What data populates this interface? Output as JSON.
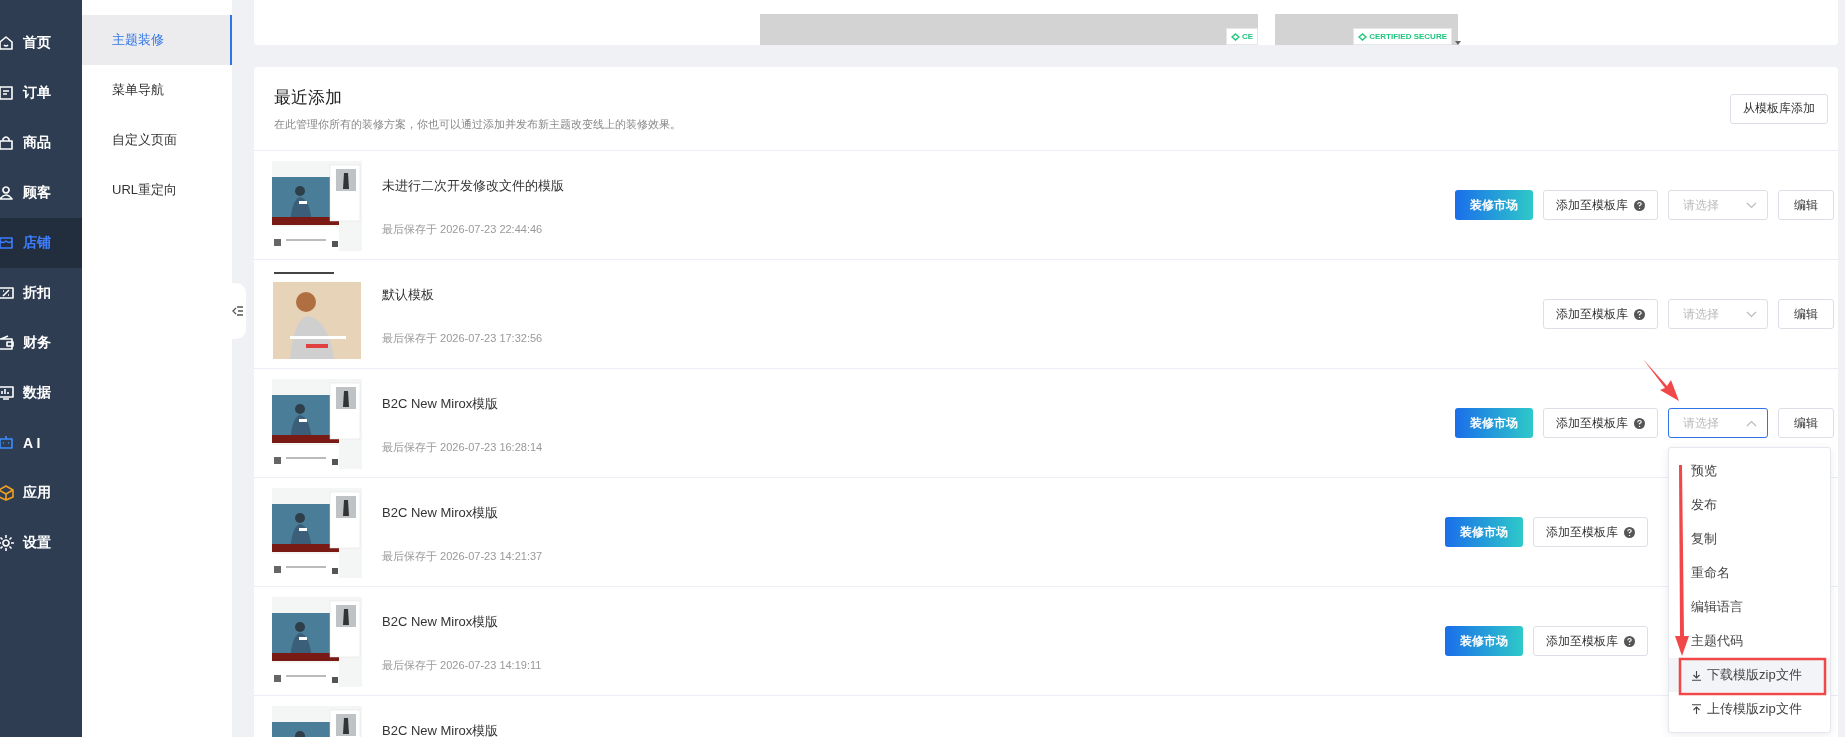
{
  "sidebar": {
    "items": [
      {
        "label": "首页",
        "selected": false
      },
      {
        "label": "订单",
        "selected": false
      },
      {
        "label": "商品",
        "selected": false
      },
      {
        "label": "顾客",
        "selected": false
      },
      {
        "label": "店铺",
        "selected": true
      },
      {
        "label": "折扣",
        "selected": false
      },
      {
        "label": "财务",
        "selected": false
      },
      {
        "label": "数据",
        "selected": false
      },
      {
        "label": "A I",
        "selected": false
      },
      {
        "label": "应用",
        "selected": false
      },
      {
        "label": "设置",
        "selected": false
      }
    ]
  },
  "subnav": {
    "items": [
      {
        "label": "主题装修",
        "selected": true
      },
      {
        "label": "菜单导航",
        "selected": false
      },
      {
        "label": "自定义页面",
        "selected": false
      },
      {
        "label": "URL重定向",
        "selected": false
      }
    ]
  },
  "preview_card": {
    "badges": [
      "CE",
      "CERTIFIED SECURE"
    ]
  },
  "recent": {
    "title": "最近添加",
    "subtitle": "在此管理你所有的装修方案，你也可以通过添加并发布新主题改变线上的装修效果。",
    "add_from_library": "从模板库添加",
    "rows": [
      {
        "title": "未进行二次开发修改文件的模版",
        "saved": "最后保存于 2026-07-23 22:44:46",
        "market_button": "装修市场",
        "add_button": "添加至模板库",
        "select": {
          "placeholder": "请选择",
          "open": false
        },
        "edit_button": "编辑"
      },
      {
        "title": "默认模板",
        "saved": "最后保存于 2026-07-23 17:32:56",
        "add_button": "添加至模板库",
        "select": {
          "placeholder": "请选择",
          "open": false
        },
        "edit_button": "编辑"
      },
      {
        "title": "B2C New Mirox模版",
        "saved": "最后保存于 2026-07-23 16:28:14",
        "market_button": "装修市场",
        "add_button": "添加至模板库",
        "select": {
          "placeholder": "请选择",
          "open": true,
          "options": [
            {
              "kind": "plain",
              "label": "预览",
              "selected": false
            },
            {
              "kind": "plain",
              "label": "发布",
              "selected": false
            },
            {
              "kind": "plain",
              "label": "复制",
              "selected": false
            },
            {
              "kind": "plain",
              "label": "重命名",
              "selected": false
            },
            {
              "kind": "plain",
              "label": "编辑语言",
              "selected": false
            },
            {
              "kind": "plain",
              "label": "主题代码",
              "selected": false
            },
            {
              "kind": "download",
              "label": "下载模版zip文件",
              "selected": true
            },
            {
              "kind": "upload",
              "label": "上传模版zip文件",
              "selected": false
            }
          ]
        },
        "edit_button": "编辑"
      },
      {
        "title": "B2C New Mirox模版",
        "saved": "最后保存于 2026-07-23 14:21:37",
        "market_button": "装修市场",
        "add_button": "添加至模板库"
      },
      {
        "title": "B2C New Mirox模版",
        "saved": "最后保存于 2026-07-23 14:19:11",
        "market_button": "装修市场",
        "add_button": "添加至模板库"
      },
      {
        "title": "B2C New Mirox模版"
      }
    ]
  }
}
